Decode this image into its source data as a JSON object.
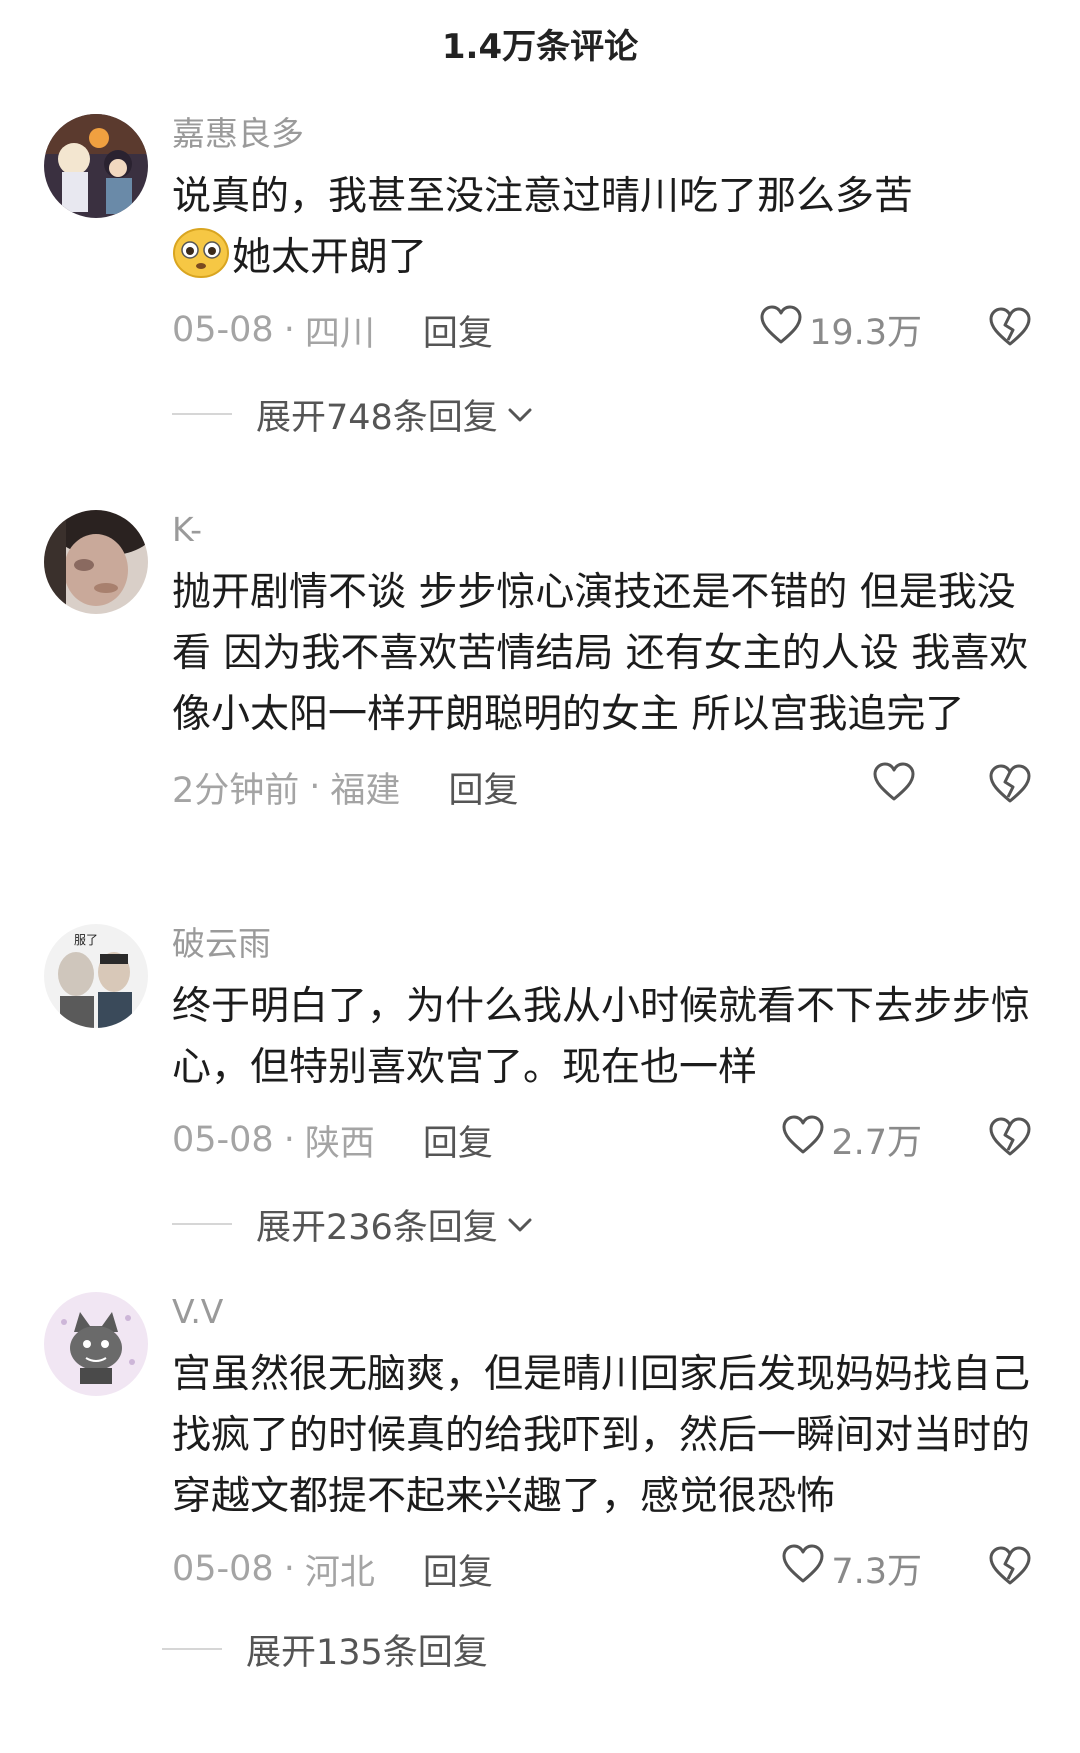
{
  "header": {
    "title": "1.4万条评论"
  },
  "comments": [
    {
      "username": "嘉惠良多",
      "text_before_emoji": "说真的，我甚至没注意过晴川吃了那么多苦",
      "emoji": "flushed-face-emoji",
      "text_after_emoji": "她太开朗了",
      "date": "05-08",
      "dot": "·",
      "location": "四川",
      "reply_label": "回复",
      "likes": "19.3万",
      "expand_text": "展开748条回复"
    },
    {
      "username": "K-",
      "text": "抛开剧情不谈 步步惊心演技还是不错的 但是我没看 因为我不喜欢苦情结局 还有女主的人设 我喜欢像小太阳一样开朗聪明的女主 所以宫我追完了",
      "date": "2分钟前",
      "dot": "·",
      "location": "福建",
      "reply_label": "回复",
      "likes": ""
    },
    {
      "username": "破云雨",
      "avatar_caption": "服了",
      "text": "终于明白了，为什么我从小时候就看不下去步步惊心，但特别喜欢宫了。现在也一样",
      "date": "05-08",
      "dot": "·",
      "location": "陕西",
      "reply_label": "回复",
      "likes": "2.7万",
      "expand_text": "展开236条回复"
    },
    {
      "username": "V.V",
      "text": "宫虽然很无脑爽，但是晴川回家后发现妈妈找自己找疯了的时候真的给我吓到，然后一瞬间对当时的穿越文都提不起来兴趣了，感觉很恐怖",
      "date": "05-08",
      "dot": "·",
      "location": "河北",
      "reply_label": "回复",
      "likes": "7.3万",
      "expand_text": "展开135条回复"
    }
  ],
  "colors": {
    "meta_gray": "#a4a4a4",
    "username_gray": "#9a9a9a",
    "text_dark": "#1c1c1c"
  }
}
